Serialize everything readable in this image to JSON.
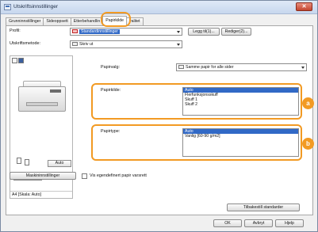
{
  "window": {
    "title": "Utskriftsinnstillinger",
    "close_label": "✕"
  },
  "tabs": [
    {
      "label": "Grunninnstillinger",
      "active": false
    },
    {
      "label": "Sideoppsett",
      "active": false
    },
    {
      "label": "Etterbehandlin",
      "active": false
    },
    {
      "label": "Papirkilde",
      "active": true
    },
    {
      "label": "valitet",
      "active": false
    }
  ],
  "profile": {
    "label": "Profil:",
    "value": "Standardinnstillinger",
    "add_button": "Legg til(1)...",
    "edit_button": "Rediger(2)..."
  },
  "output_method": {
    "label": "Utskriftsmetode:",
    "value": "Skriv ut"
  },
  "preview": {
    "auto_button": "Auto",
    "toggle_left": "▯",
    "toggle_right": "▯▯",
    "caption": "A4 [Skala: Auto]"
  },
  "paper_selection": {
    "label": "Papirvalg:",
    "value": "Samme papir for alle sider"
  },
  "paper_source": {
    "label": "Papirkilde:",
    "options": [
      "Auto",
      "Flerfunksjonsskuff",
      "Skuff 1",
      "Skuff 2"
    ],
    "selected": 0,
    "callout": "a"
  },
  "paper_type": {
    "label": "Papirtype:",
    "options": [
      "Auto",
      "Vanlig [60-90 g/m2]"
    ],
    "selected": 0,
    "callout": "b"
  },
  "printer_settings_button": "Maskininnstillinger",
  "custom_paper_checkbox": {
    "label": "Vis egendefinert papir varsrett",
    "checked": false
  },
  "restore_defaults_button": "Tilbakestill standarder",
  "footer": {
    "ok": "OK",
    "cancel": "Avbryt",
    "help": "Hjelp"
  },
  "colors": {
    "accent": "#f29a23",
    "selection": "#3169c6"
  }
}
